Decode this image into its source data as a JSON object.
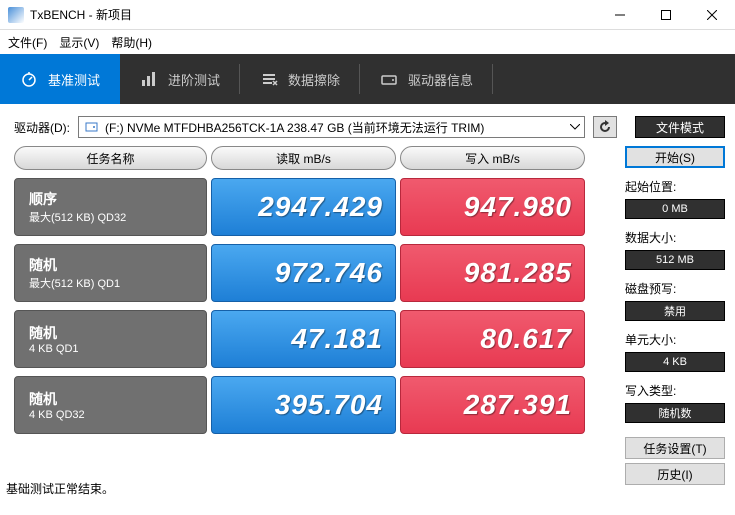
{
  "window": {
    "title": "TxBENCH - 新项目"
  },
  "menu": {
    "file": "文件(F)",
    "view": "显示(V)",
    "help": "帮助(H)"
  },
  "tabs": {
    "benchmark": "基准测试",
    "advanced": "进阶测试",
    "erase": "数据擦除",
    "driveinfo": "驱动器信息"
  },
  "toolbar": {
    "drive_label": "驱动器(D):",
    "drive_value": "(F:) NVMe MTFDHBA256TCK-1A  238.47 GB (当前环境无法运行 TRIM)",
    "file_mode": "文件模式"
  },
  "headers": {
    "name": "任务名称",
    "read": "读取 mB/s",
    "write": "写入 mB/s"
  },
  "rows": [
    {
      "title": "顺序",
      "sub": "最大(512 KB) QD32",
      "read": "2947.429",
      "write": "947.980"
    },
    {
      "title": "随机",
      "sub": "最大(512 KB) QD1",
      "read": "972.746",
      "write": "981.285"
    },
    {
      "title": "随机",
      "sub": "4 KB QD1",
      "read": "47.181",
      "write": "80.617"
    },
    {
      "title": "随机",
      "sub": "4 KB QD32",
      "read": "395.704",
      "write": "287.391"
    }
  ],
  "side": {
    "start": "开始(S)",
    "start_pos_label": "起始位置:",
    "start_pos_val": "0 MB",
    "data_size_label": "数据大小:",
    "data_size_val": "512 MB",
    "prefill_label": "磁盘预写:",
    "prefill_val": "禁用",
    "unit_label": "单元大小:",
    "unit_val": "4 KB",
    "write_type_label": "写入类型:",
    "write_type_val": "随机数",
    "task_settings": "任务设置(T)",
    "history": "历史(I)"
  },
  "status": "基础测试正常结束。",
  "chart_data": {
    "type": "table",
    "title": "TxBENCH Benchmark Results",
    "columns": [
      "任务名称",
      "读取 mB/s",
      "写入 mB/s"
    ],
    "rows": [
      [
        "顺序 最大(512 KB) QD32",
        2947.429,
        947.98
      ],
      [
        "随机 最大(512 KB) QD1",
        972.746,
        981.285
      ],
      [
        "随机 4 KB QD1",
        47.181,
        80.617
      ],
      [
        "随机 4 KB QD32",
        395.704,
        287.391
      ]
    ]
  }
}
